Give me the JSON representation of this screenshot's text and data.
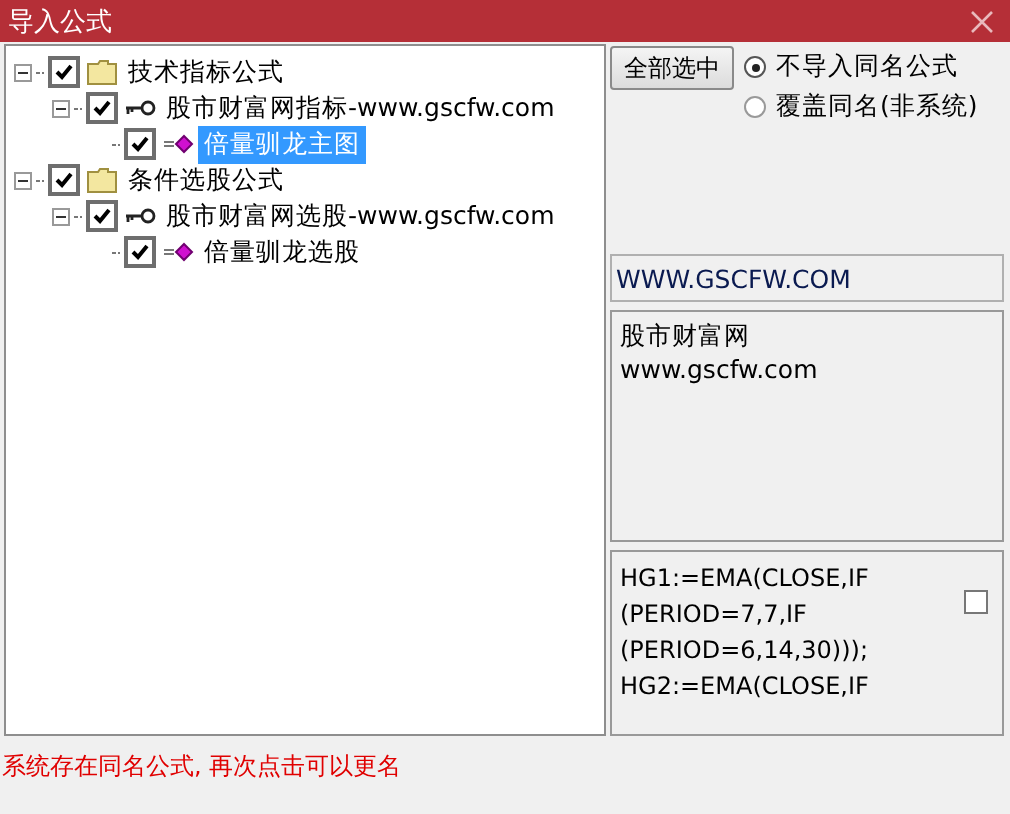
{
  "window": {
    "title": "导入公式"
  },
  "tree": [
    {
      "label": "技术指标公式",
      "kind": "folder",
      "checked": true,
      "expanded": true,
      "selected": false,
      "children": [
        {
          "label": "股市财富网指标-www.gscfw.com",
          "kind": "key",
          "checked": true,
          "expanded": true,
          "selected": false,
          "children": [
            {
              "label": "倍量驯龙主图",
              "kind": "formula",
              "checked": true,
              "selected": true
            }
          ]
        }
      ]
    },
    {
      "label": "条件选股公式",
      "kind": "folder",
      "checked": true,
      "expanded": true,
      "selected": false,
      "children": [
        {
          "label": "股市财富网选股-www.gscfw.com",
          "kind": "key",
          "checked": true,
          "expanded": true,
          "selected": false,
          "children": [
            {
              "label": "倍量驯龙选股",
              "kind": "formula",
              "checked": true,
              "selected": false
            }
          ]
        }
      ]
    }
  ],
  "select_all_button": "全部选中",
  "options": [
    {
      "label": "不导入同名公式",
      "selected": true
    },
    {
      "label": "覆盖同名(非系统)",
      "selected": false
    }
  ],
  "password_field": {
    "value": "WWW.GSCFW.COM"
  },
  "description": [
    "股市财富网",
    "www.gscfw.com"
  ],
  "formula_text": [
    "HG1:=EMA(CLOSE,IF",
    "(PERIOD=7,7,IF",
    "(PERIOD=6,14,30)));",
    "HG2:=EMA(CLOSE,IF"
  ],
  "formula_checkbox": {
    "checked": false
  },
  "status_message": "系统存在同名公式, 再次点击可以更名"
}
